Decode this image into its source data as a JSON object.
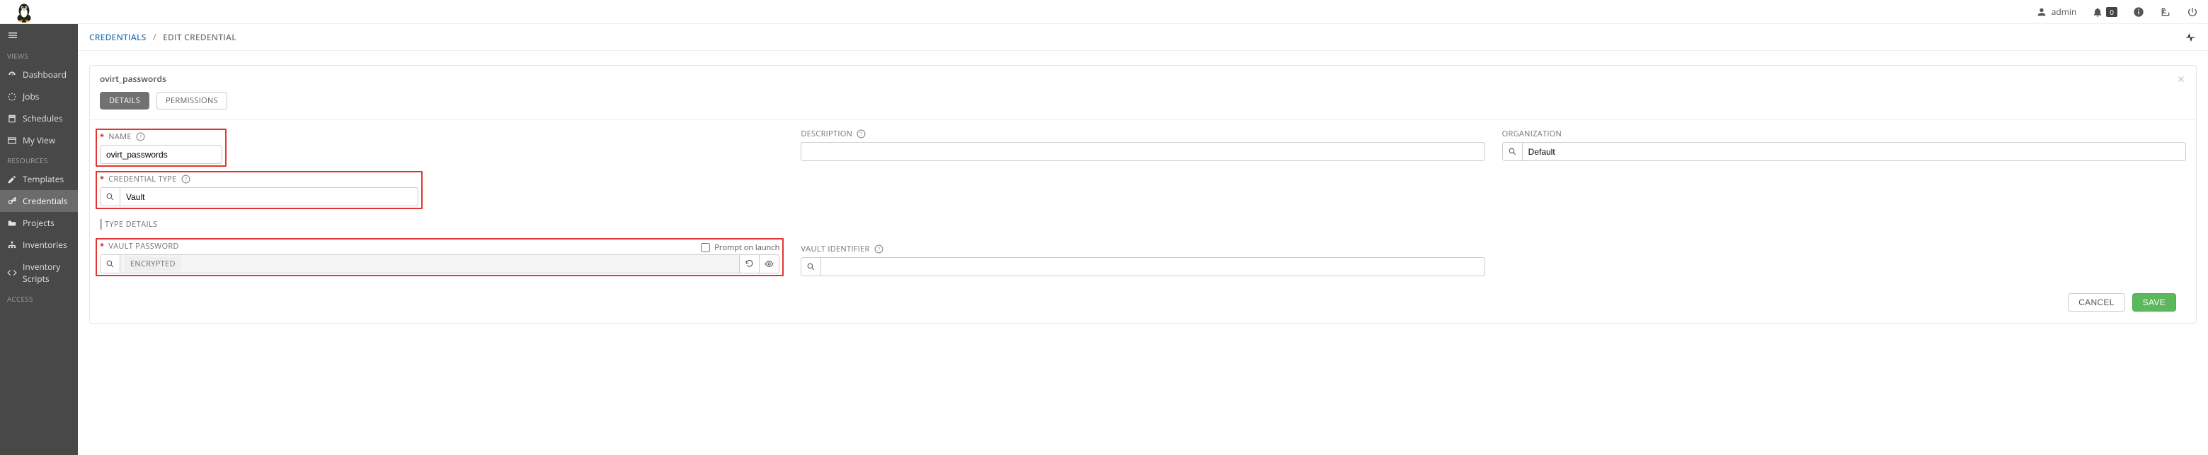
{
  "topbar": {
    "user_label": "admin",
    "notif_count": "0"
  },
  "sidebar": {
    "groups": {
      "views": "VIEWS",
      "resources": "RESOURCES",
      "access": "ACCESS"
    },
    "items": {
      "dashboard": "Dashboard",
      "jobs": "Jobs",
      "schedules": "Schedules",
      "myview": "My View",
      "templates": "Templates",
      "credentials": "Credentials",
      "projects": "Projects",
      "inventories": "Inventories",
      "inventory_scripts": "Inventory Scripts"
    }
  },
  "breadcrumb": {
    "root": "CREDENTIALS",
    "current": "EDIT CREDENTIAL"
  },
  "panel": {
    "title": "ovirt_passwords"
  },
  "tabs": {
    "details": "DETAILS",
    "permissions": "PERMISSIONS"
  },
  "form": {
    "name_label": "NAME",
    "name_value": "ovirt_passwords",
    "description_label": "DESCRIPTION",
    "description_value": "",
    "organization_label": "ORGANIZATION",
    "organization_value": "Default",
    "credential_type_label": "CREDENTIAL TYPE",
    "credential_type_value": "Vault",
    "type_details_label": "TYPE DETAILS",
    "vault_password_label": "VAULT PASSWORD",
    "vault_password_value": "ENCRYPTED",
    "prompt_on_launch_label": "Prompt on launch",
    "vault_identifier_label": "VAULT IDENTIFIER",
    "vault_identifier_value": ""
  },
  "actions": {
    "cancel": "CANCEL",
    "save": "SAVE"
  }
}
